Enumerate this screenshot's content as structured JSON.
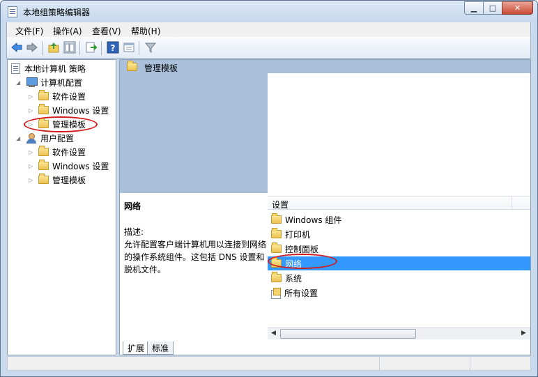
{
  "window": {
    "title": "本地组策略编辑器",
    "buttons": {
      "minimize": "▁",
      "maximize": "□",
      "close": "✕"
    }
  },
  "menu": [
    {
      "label": "文件(F)"
    },
    {
      "label": "操作(A)"
    },
    {
      "label": "查看(V)"
    },
    {
      "label": "帮助(H)"
    }
  ],
  "toolbar": {
    "icons": [
      "back-arrow-icon",
      "forward-arrow-icon",
      "up-folder-icon",
      "show-hide-tree-icon",
      "export-list-icon",
      "help-icon",
      "properties-icon",
      "filter-icon"
    ]
  },
  "tree": {
    "root": "本地计算机 策略",
    "computer": {
      "label": "计算机配置",
      "children": [
        "软件设置",
        "Windows 设置",
        "管理模板"
      ]
    },
    "user": {
      "label": "用户配置",
      "children": [
        "软件设置",
        "Windows 设置",
        "管理模板"
      ]
    },
    "selected": "管理模板"
  },
  "right_pane": {
    "header": "管理模板",
    "description": {
      "title": "网络",
      "label": "描述:",
      "text": "允许配置客户端计算机用以连接到网络的操作系统组件。这包括 DNS 设置和脱机文件。"
    },
    "list_header": "设置",
    "items": [
      "Windows 组件",
      "打印机",
      "控制面板",
      "网络",
      "系统",
      "所有设置"
    ],
    "selected_item": "网络"
  },
  "tabs": [
    "扩展",
    "标准"
  ],
  "colors": {
    "accent": "#3399ff",
    "highlight_circle": "#d21b1b",
    "header_band": "#a9bfda"
  }
}
